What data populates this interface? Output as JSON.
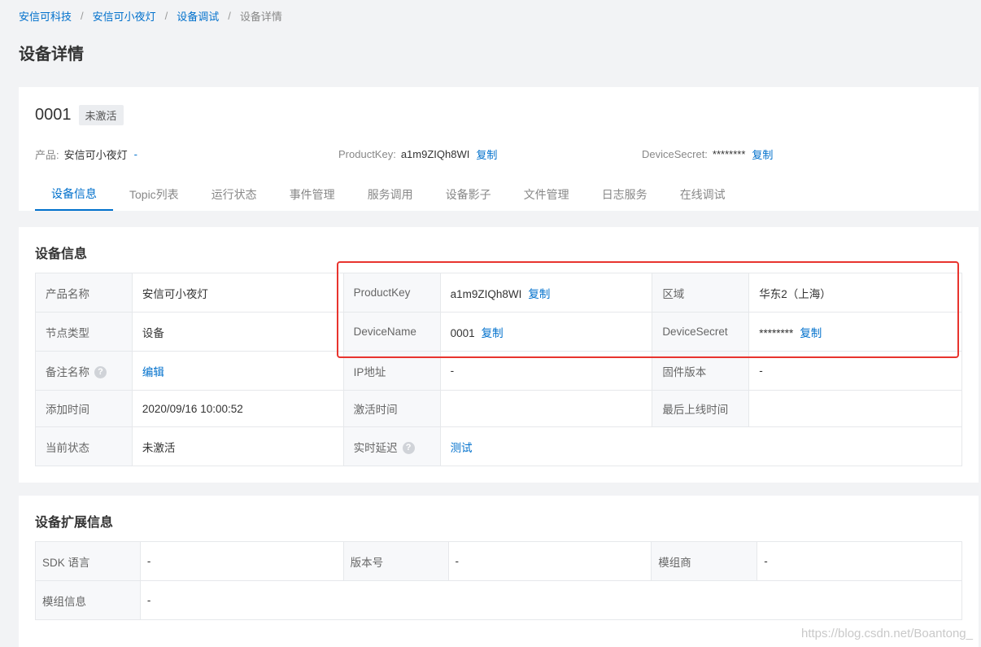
{
  "breadcrumb": [
    "安信可科技",
    "安信可小夜灯",
    "设备调试",
    "设备详情"
  ],
  "page_title": "设备详情",
  "device": {
    "name": "0001",
    "status_badge": "未激活",
    "product_label": "产品:",
    "product_value": "安信可小夜灯",
    "product_link": "-",
    "productkey_label": "ProductKey:",
    "productkey_value": "a1m9ZIQh8WI",
    "devicesecret_label": "DeviceSecret:",
    "devicesecret_value": "********",
    "copy_label": "复制"
  },
  "tabs": [
    "设备信息",
    "Topic列表",
    "运行状态",
    "事件管理",
    "服务调用",
    "设备影子",
    "文件管理",
    "日志服务",
    "在线调试"
  ],
  "device_info": {
    "title": "设备信息",
    "rows": [
      {
        "k1": "产品名称",
        "v1": "安信可小夜灯",
        "k2": "ProductKey",
        "v2": "a1m9ZIQh8WI",
        "k3": "区域",
        "v3": "华东2（上海）"
      },
      {
        "k1": "节点类型",
        "v1": "设备",
        "k2": "DeviceName",
        "v2": "0001",
        "k3": "DeviceSecret",
        "v3": "********"
      },
      {
        "k1": "备注名称",
        "v1": "编辑",
        "k2": "IP地址",
        "v2": "-",
        "k3": "固件版本",
        "v3": "-"
      },
      {
        "k1": "添加时间",
        "v1": "2020/09/16 10:00:52",
        "k2": "激活时间",
        "v2": "",
        "k3": "最后上线时间",
        "v3": ""
      },
      {
        "k1": "当前状态",
        "v1": "未激活",
        "k2": "实时延迟",
        "v2": "测试"
      }
    ],
    "help_glyph": "?"
  },
  "ext_info": {
    "title": "设备扩展信息",
    "rows": [
      {
        "k1": "SDK 语言",
        "v1": "-",
        "k2": "版本号",
        "v2": "-",
        "k3": "模组商",
        "v3": "-"
      },
      {
        "k1": "模组信息",
        "v1": "-"
      }
    ]
  },
  "watermark": "https://blog.csdn.net/Boantong_",
  "colors": {
    "accent": "#0070cc",
    "highlight": "#e8342e"
  }
}
